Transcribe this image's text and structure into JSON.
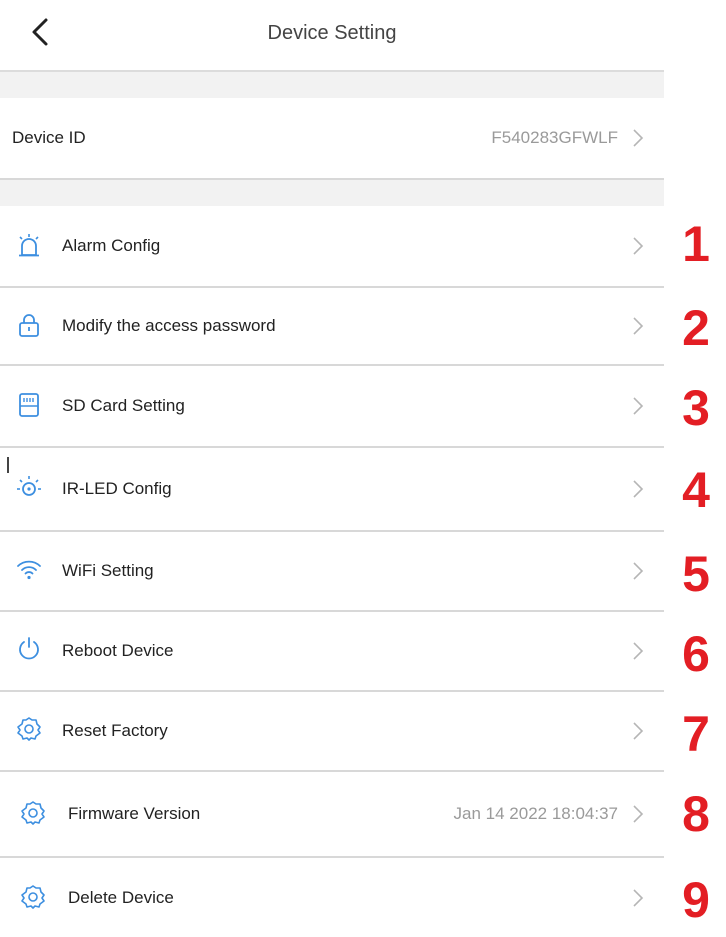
{
  "header": {
    "title": "Device Setting"
  },
  "device_id": {
    "label": "Device ID",
    "value": "F540283GFWLF"
  },
  "menu": [
    {
      "label": "Alarm Config",
      "icon": "alarm-icon",
      "value": ""
    },
    {
      "label": "Modify the access password",
      "icon": "lock-icon",
      "value": ""
    },
    {
      "label": "SD Card Setting",
      "icon": "sd-card-icon",
      "value": ""
    },
    {
      "label": "IR-LED Config",
      "icon": "ir-led-icon",
      "value": ""
    },
    {
      "label": "WiFi Setting",
      "icon": "wifi-icon",
      "value": ""
    },
    {
      "label": "Reboot Device",
      "icon": "power-icon",
      "value": ""
    },
    {
      "label": "Reset Factory",
      "icon": "gear-icon",
      "value": ""
    },
    {
      "label": "Firmware Version",
      "icon": "gear-icon",
      "value": "Jan 14 2022 18:04:37"
    },
    {
      "label": "Delete Device",
      "icon": "gear-icon",
      "value": ""
    }
  ],
  "annotations": [
    "1",
    "2",
    "3",
    "4",
    "5",
    "6",
    "7",
    "8",
    "9"
  ],
  "colors": {
    "icon_blue": "#3d8fe0",
    "annotation_red": "#e31e24",
    "chevron_gray": "#b5b5b5"
  }
}
